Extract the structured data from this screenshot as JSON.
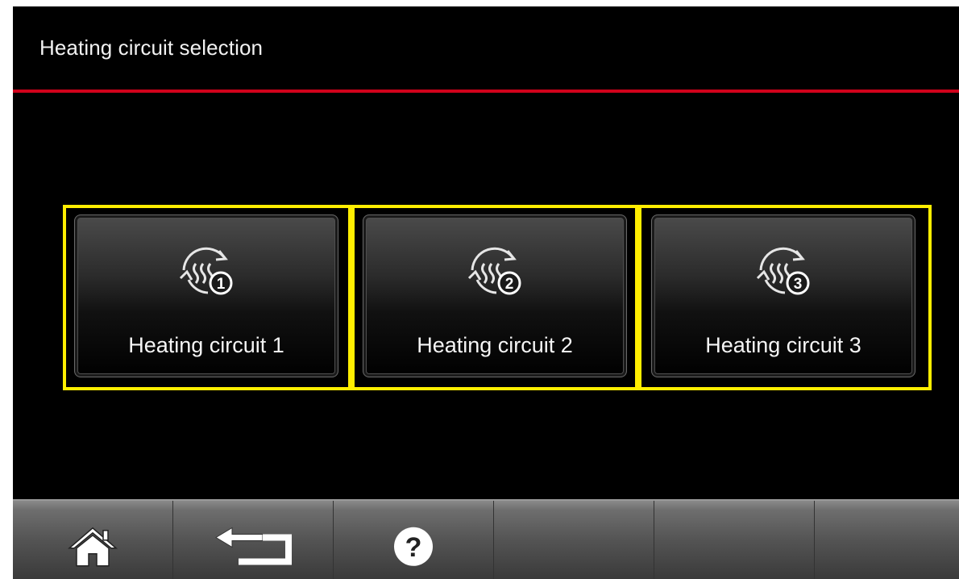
{
  "header": {
    "title": "Heating circuit selection"
  },
  "circuits": [
    {
      "label": "Heating circuit 1",
      "number": "1",
      "icon": "heating-circuit-icon"
    },
    {
      "label": "Heating circuit 2",
      "number": "2",
      "icon": "heating-circuit-icon"
    },
    {
      "label": "Heating circuit 3",
      "number": "3",
      "icon": "heating-circuit-icon"
    }
  ],
  "bottom_bar": {
    "items": [
      {
        "icon": "home-icon"
      },
      {
        "icon": "back-icon"
      },
      {
        "icon": "help-icon",
        "glyph": "?"
      },
      {
        "icon": ""
      },
      {
        "icon": ""
      },
      {
        "icon": ""
      }
    ]
  },
  "colors": {
    "accent_line": "#d0021b",
    "highlight_frame": "#ffee00",
    "background": "#000000"
  }
}
